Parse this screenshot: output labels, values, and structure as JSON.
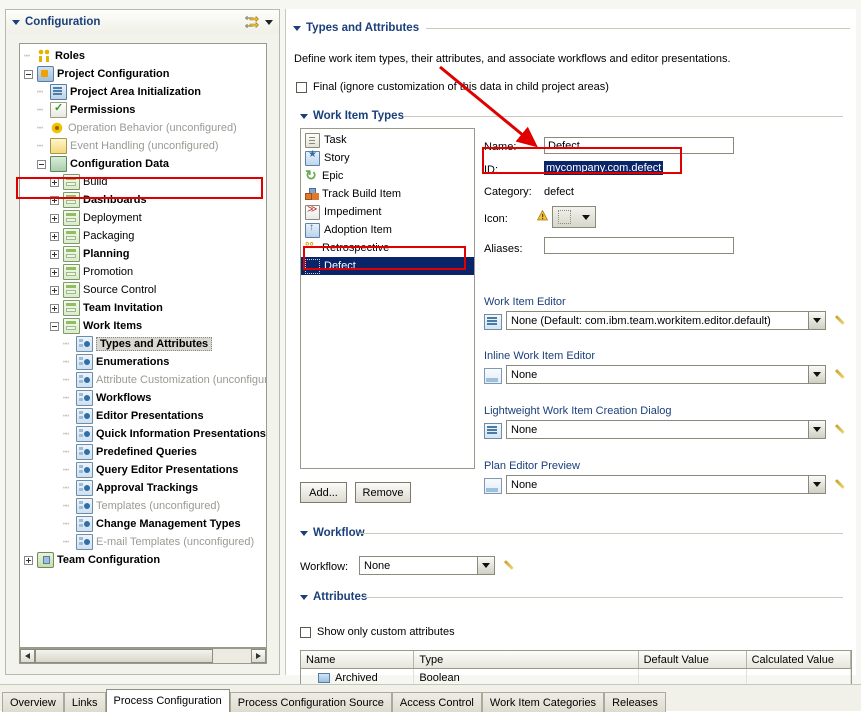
{
  "left_panel": {
    "title": "Configuration",
    "toolbar": {
      "link_icon": "link-with-editor-icon",
      "menu_icon": "chevron-down-icon"
    },
    "tree": [
      {
        "label": "Roles",
        "depth": 1,
        "icon": "roles-icon",
        "style": "bold",
        "expander": "none"
      },
      {
        "label": "Project Configuration",
        "depth": 1,
        "icon": "project-icon",
        "style": "bold",
        "expander": "minus"
      },
      {
        "label": "Project Area Initialization",
        "depth": 2,
        "icon": "init-icon",
        "style": "bold",
        "expander": "none"
      },
      {
        "label": "Permissions",
        "depth": 2,
        "icon": "permissions-icon",
        "style": "bold",
        "expander": "none"
      },
      {
        "label": "Operation Behavior (unconfigured)",
        "depth": 2,
        "icon": "gear-icon",
        "style": "dim",
        "expander": "none"
      },
      {
        "label": "Event Handling (unconfigured)",
        "depth": 2,
        "icon": "flag-icon",
        "style": "dim",
        "expander": "none"
      },
      {
        "label": "Configuration Data",
        "depth": 2,
        "icon": "config-data-icon",
        "style": "bold",
        "expander": "minus"
      },
      {
        "label": "Build",
        "depth": 3,
        "icon": "folder-icon",
        "style": "normal",
        "expander": "plus"
      },
      {
        "label": "Dashboards",
        "depth": 3,
        "icon": "folder-icon",
        "style": "bold",
        "expander": "plus"
      },
      {
        "label": "Deployment",
        "depth": 3,
        "icon": "folder-icon",
        "style": "normal",
        "expander": "plus"
      },
      {
        "label": "Packaging",
        "depth": 3,
        "icon": "folder-icon",
        "style": "normal",
        "expander": "plus"
      },
      {
        "label": "Planning",
        "depth": 3,
        "icon": "folder-icon",
        "style": "bold",
        "expander": "plus"
      },
      {
        "label": "Promotion",
        "depth": 3,
        "icon": "folder-icon",
        "style": "normal",
        "expander": "plus"
      },
      {
        "label": "Source Control",
        "depth": 3,
        "icon": "folder-icon",
        "style": "normal",
        "expander": "plus"
      },
      {
        "label": "Team Invitation",
        "depth": 3,
        "icon": "folder-icon",
        "style": "bold",
        "expander": "plus"
      },
      {
        "label": "Work Items",
        "depth": 3,
        "icon": "folder-icon",
        "style": "bold",
        "expander": "minus"
      },
      {
        "label": "Types and Attributes",
        "depth": 4,
        "icon": "leaf-icon",
        "style": "bold",
        "expander": "none",
        "selected": true,
        "highlight": true
      },
      {
        "label": "Enumerations",
        "depth": 4,
        "icon": "leaf-icon",
        "style": "bold",
        "expander": "none"
      },
      {
        "label": "Attribute Customization (unconfigured)",
        "depth": 4,
        "icon": "leaf-icon",
        "style": "dim",
        "expander": "none"
      },
      {
        "label": "Workflows",
        "depth": 4,
        "icon": "leaf-icon",
        "style": "bold",
        "expander": "none"
      },
      {
        "label": "Editor Presentations",
        "depth": 4,
        "icon": "leaf-icon",
        "style": "bold",
        "expander": "none"
      },
      {
        "label": "Quick Information Presentations",
        "depth": 4,
        "icon": "leaf-icon",
        "style": "bold",
        "expander": "none"
      },
      {
        "label": "Predefined Queries",
        "depth": 4,
        "icon": "leaf-icon",
        "style": "bold",
        "expander": "none"
      },
      {
        "label": "Query Editor Presentations",
        "depth": 4,
        "icon": "leaf-icon",
        "style": "bold",
        "expander": "none"
      },
      {
        "label": "Approval Trackings",
        "depth": 4,
        "icon": "leaf-icon",
        "style": "bold",
        "expander": "none"
      },
      {
        "label": "Templates (unconfigured)",
        "depth": 4,
        "icon": "leaf-icon",
        "style": "dim",
        "expander": "none"
      },
      {
        "label": "Change Management Types",
        "depth": 4,
        "icon": "leaf-icon",
        "style": "bold",
        "expander": "none"
      },
      {
        "label": "E-mail Templates (unconfigured)",
        "depth": 4,
        "icon": "leaf-icon",
        "style": "dim",
        "expander": "none"
      },
      {
        "label": "Team Configuration",
        "depth": 1,
        "icon": "team-config-icon",
        "style": "bold",
        "expander": "plus"
      }
    ]
  },
  "right_panel": {
    "title": "Types and Attributes",
    "description": "Define work item types, their attributes, and associate workflows and editor presentations.",
    "final_checkbox": {
      "label": "Final (ignore customization of this data in child project areas)",
      "checked": false
    },
    "work_item_types": {
      "title": "Work Item Types",
      "items": [
        {
          "label": "Task",
          "icon": "task-icon"
        },
        {
          "label": "Story",
          "icon": "story-icon"
        },
        {
          "label": "Epic",
          "icon": "epic-icon"
        },
        {
          "label": "Track Build Item",
          "icon": "build-icon"
        },
        {
          "label": "Impediment",
          "icon": "impediment-icon"
        },
        {
          "label": "Adoption Item",
          "icon": "adoption-icon"
        },
        {
          "label": "Retrospective",
          "icon": "retrospective-icon"
        },
        {
          "label": "Defect",
          "icon": "defect-icon",
          "selected": true,
          "highlight": true
        }
      ],
      "add_button": "Add...",
      "remove_button": "Remove"
    },
    "details": {
      "name_label": "Name:",
      "name_value": "Defect",
      "id_label": "ID:",
      "id_value": "mycompany.com.defect",
      "id_highlight": true,
      "category_label": "Category:",
      "category_value": "defect",
      "icon_label": "Icon:",
      "icon_warning": "warning-icon",
      "aliases_label": "Aliases:",
      "aliases_value": "",
      "editors": [
        {
          "label": "Work Item Editor",
          "value": "None (Default: com.ibm.team.workitem.editor.default)",
          "icon": "editor-list-icon"
        },
        {
          "label": "Inline Work Item Editor",
          "value": "None",
          "icon": "editor-window-icon"
        },
        {
          "label": "Lightweight Work Item Creation Dialog",
          "value": "None",
          "icon": "editor-list-icon"
        },
        {
          "label": "Plan Editor Preview",
          "value": "None",
          "icon": "editor-window-icon"
        }
      ]
    },
    "workflow": {
      "title": "Workflow",
      "label": "Workflow:",
      "value": "None"
    },
    "attributes": {
      "title": "Attributes",
      "show_custom_only": {
        "label": "Show only custom attributes",
        "checked": false
      },
      "columns": [
        "Name",
        "Type",
        "Default Value",
        "Calculated Value"
      ],
      "rows": [
        {
          "name": "Archived",
          "type": "Boolean",
          "default_value": "",
          "calculated_value": ""
        }
      ]
    }
  },
  "bottom_tabs": {
    "items": [
      {
        "label": "Overview",
        "active": false
      },
      {
        "label": "Links",
        "active": false
      },
      {
        "label": "Process Configuration",
        "active": true
      },
      {
        "label": "Process Configuration Source",
        "active": false
      },
      {
        "label": "Access Control",
        "active": false
      },
      {
        "label": "Work Item Categories",
        "active": false
      },
      {
        "label": "Releases",
        "active": false
      }
    ]
  },
  "annotations": {
    "arrow_color": "#e00000",
    "box_color": "#e00000"
  }
}
